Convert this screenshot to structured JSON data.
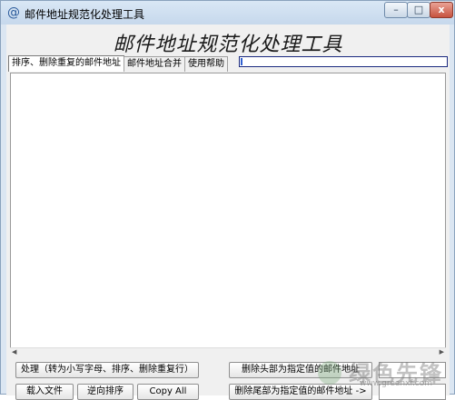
{
  "window": {
    "title": "邮件地址规范化处理工具",
    "app_icon_glyph": "@",
    "controls": {
      "minimize_glyph": "–",
      "maximize_glyph": "□",
      "close_glyph": "x"
    }
  },
  "header": {
    "title": "邮件地址规范化处理工具"
  },
  "tabs": [
    {
      "label": "排序、删除重复的邮件地址",
      "active": true
    },
    {
      "label": "邮件地址合并",
      "active": false
    },
    {
      "label": "使用帮助",
      "active": false
    }
  ],
  "progress": {
    "value": 0.01
  },
  "editor": {
    "content": ""
  },
  "buttons": {
    "process": "处理（转为小写字母、排序、删除重复行）",
    "delete_head": "删除头部为指定值的邮件地址",
    "load_file": "载入文件",
    "reverse_sort": "逆向排序",
    "copy_all": "Copy All",
    "delete_tail": "删除尾部为指定值的邮件地址 ->"
  },
  "watermark": {
    "text": "绿色先锋",
    "url": "www.greenxf.com"
  }
}
